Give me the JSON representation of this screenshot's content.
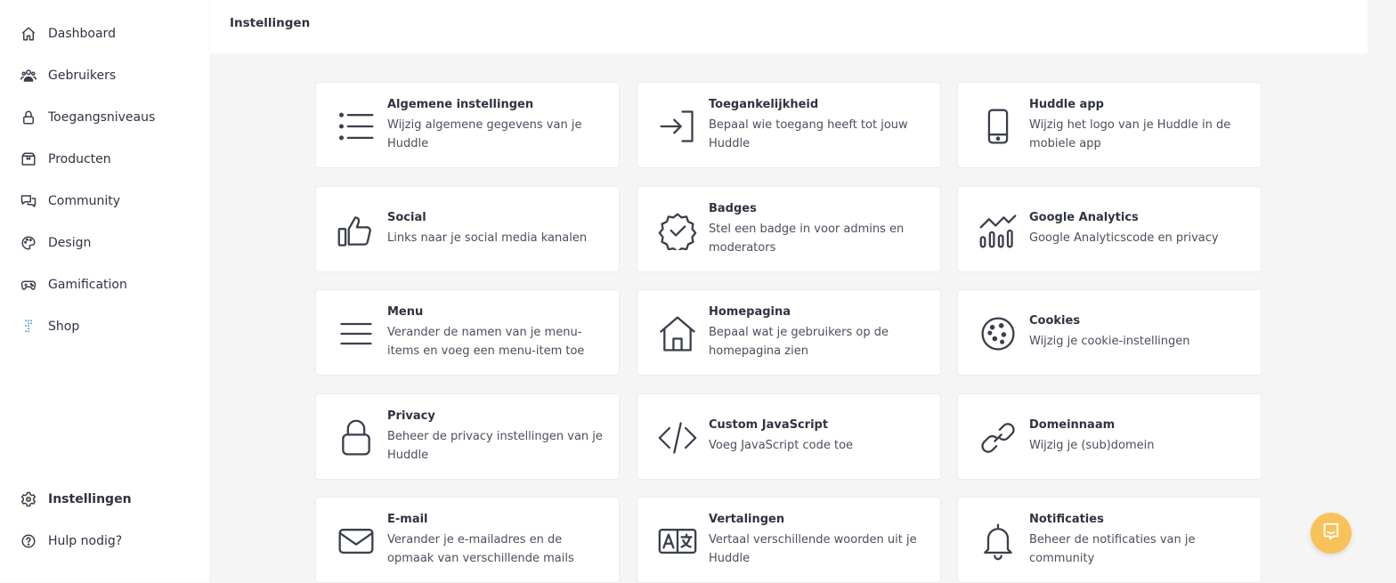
{
  "sidebar": {
    "items": [
      {
        "label": "Dashboard",
        "icon": "home-icon"
      },
      {
        "label": "Gebruikers",
        "icon": "users-icon"
      },
      {
        "label": "Toegangsniveaus",
        "icon": "lock-icon"
      },
      {
        "label": "Producten",
        "icon": "box-icon"
      },
      {
        "label": "Community",
        "icon": "chat-icon"
      },
      {
        "label": "Design",
        "icon": "palette-icon"
      },
      {
        "label": "Gamification",
        "icon": "gamepad-icon"
      },
      {
        "label": "Shop",
        "icon": "shop-icon"
      }
    ],
    "bottom": [
      {
        "label": "Instellingen",
        "icon": "gear-icon",
        "active": true
      },
      {
        "label": "Hulp nodig?",
        "icon": "help-icon"
      }
    ]
  },
  "header": {
    "title": "Instellingen"
  },
  "cards": [
    {
      "title": "Algemene instellingen",
      "desc": "Wijzig algemene gegevens van je Huddle",
      "icon": "list-icon"
    },
    {
      "title": "Toegankelijkheid",
      "desc": "Bepaal wie toegang heeft tot jouw Huddle",
      "icon": "sign-in-icon"
    },
    {
      "title": "Huddle app",
      "desc": "Wijzig het logo van je Huddle in de mobiele app",
      "icon": "mobile-icon"
    },
    {
      "title": "Social",
      "desc": "Links naar je social media kanalen",
      "icon": "thumbs-up-icon"
    },
    {
      "title": "Badges",
      "desc": "Stel een badge in voor admins en moderators",
      "icon": "badge-check-icon"
    },
    {
      "title": "Google Analytics",
      "desc": "Google Analyticscode en privacy",
      "icon": "analytics-icon"
    },
    {
      "title": "Menu",
      "desc": "Verander de namen van je menu-items en voeg een menu-item toe",
      "icon": "menu-icon"
    },
    {
      "title": "Homepagina",
      "desc": "Bepaal wat je gebruikers op de homepagina zien",
      "icon": "house-icon"
    },
    {
      "title": "Cookies",
      "desc": "Wijzig je cookie-instellingen",
      "icon": "cookie-icon"
    },
    {
      "title": "Privacy",
      "desc": "Beheer de privacy instellingen van je Huddle",
      "icon": "padlock-icon"
    },
    {
      "title": "Custom JavaScript",
      "desc": "Voeg JavaScript code toe",
      "icon": "code-icon"
    },
    {
      "title": "Domeinnaam",
      "desc": "Wijzig je (sub)domein",
      "icon": "link-icon"
    },
    {
      "title": "E-mail",
      "desc": "Verander je e-mailadres en de opmaak van verschillende mails",
      "icon": "envelope-icon"
    },
    {
      "title": "Vertalingen",
      "desc": "Vertaal verschillende woorden uit je Huddle",
      "icon": "translate-icon"
    },
    {
      "title": "Notificaties",
      "desc": "Beheer de notificaties van je community",
      "icon": "bell-icon"
    }
  ],
  "colors": {
    "accent": "#f7c25a",
    "text": "#2f3340",
    "background": "#f5f5f5",
    "icon": "#3a3f4b",
    "shop_icon": "#4aa3df"
  },
  "chat_button": {
    "icon": "chat-bubble-icon"
  }
}
